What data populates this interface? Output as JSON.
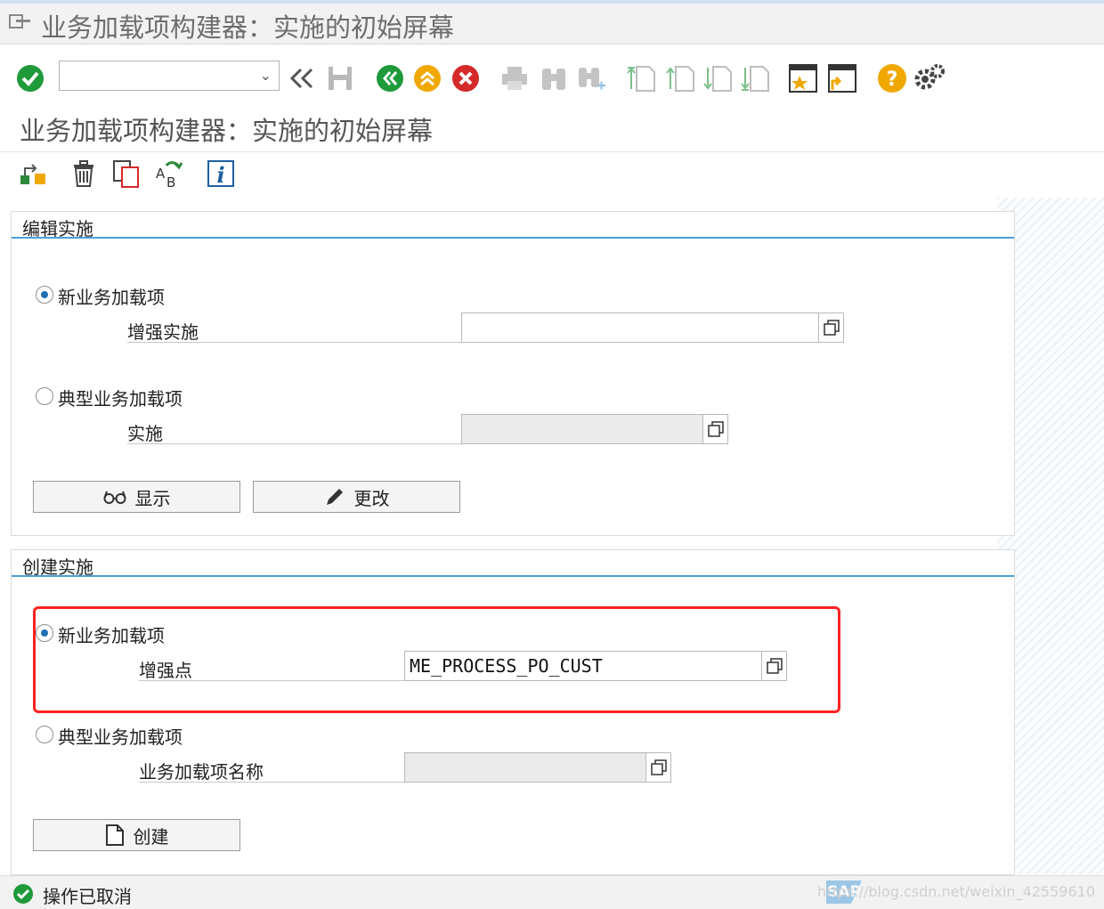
{
  "window": {
    "title": "业务加载项构建器：实施的初始屏幕"
  },
  "screen": {
    "subtitle": "业务加载项构建器：实施的初始屏幕"
  },
  "toolbar": {
    "command_field": {
      "value": ""
    },
    "icons": [
      "enter-icon",
      "back-icon",
      "save-icon",
      "back-green-icon",
      "exit-icon",
      "cancel-icon",
      "print-icon",
      "find-icon",
      "find-next-icon",
      "first-page-icon",
      "previous-page-icon",
      "next-page-icon",
      "last-page-icon",
      "create-shortcut-icon",
      "new-session-icon",
      "help-icon",
      "settings-icon"
    ]
  },
  "app_toolbar": {
    "icons": [
      "hierarchy-icon",
      "delete-icon",
      "copy-icon",
      "rename-icon",
      "info-icon"
    ]
  },
  "edit_group": {
    "title": "编辑实施",
    "option_new": "新业务加载项",
    "enhancement_label": "增强实施",
    "enhancement_value": "",
    "option_classic": "典型业务加载项",
    "impl_label": "实施",
    "impl_value": "",
    "display_button": "显示",
    "change_button": "更改"
  },
  "create_group": {
    "title": "创建实施",
    "option_new": "新业务加载项",
    "spot_label": "增强点",
    "spot_value": "ME_PROCESS_PO_CUST",
    "option_classic": "典型业务加载项",
    "badi_label": "业务加载项名称",
    "badi_value": "",
    "create_button": "创建"
  },
  "status": {
    "message": "操作已取消",
    "watermark": "https://blog.csdn.net/weixin_42559610",
    "brand": "SAP"
  },
  "colors": {
    "accent": "#4aa0d6",
    "highlight": "#ff2222",
    "green": "#1f9a3a",
    "orange": "#f0a800",
    "red": "#d42a2a"
  }
}
